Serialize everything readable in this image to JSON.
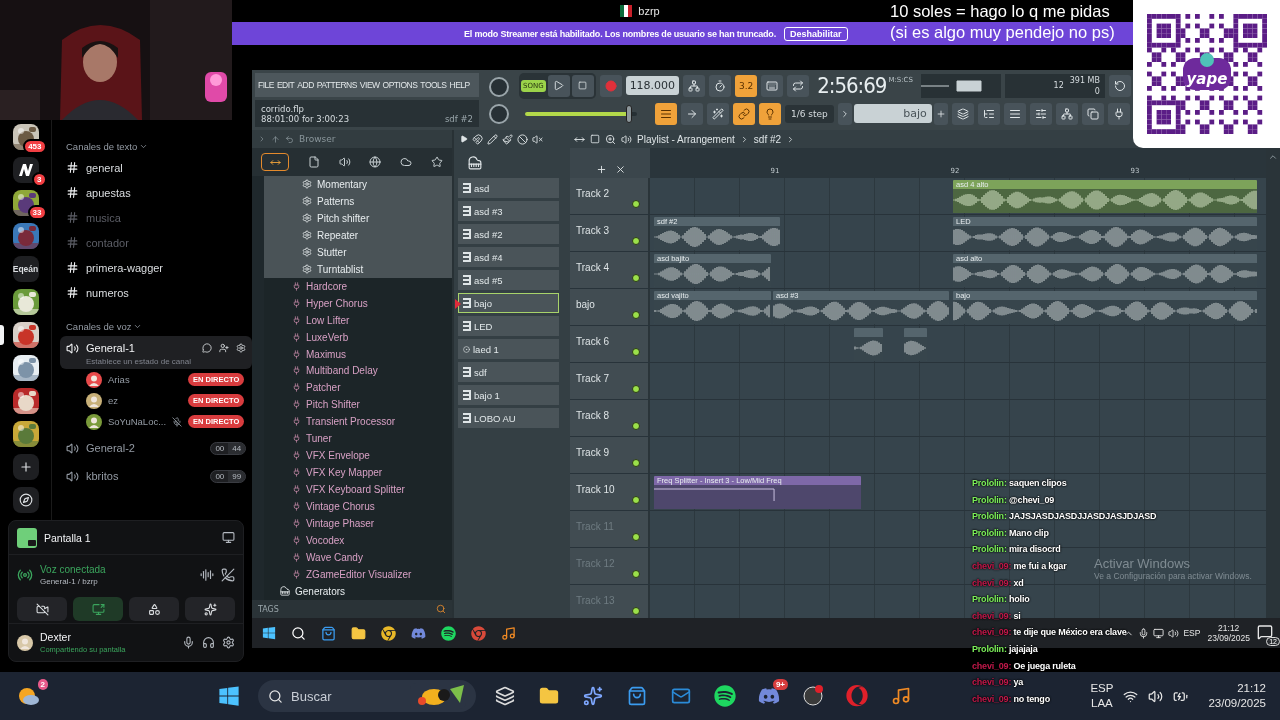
{
  "stream": {
    "title": "bzrp",
    "promo_lines": [
      "10 soles = hago lo q me pidas",
      "(si es algo muy pendejo no ps)"
    ],
    "qr_logo": "yape"
  },
  "banner": {
    "message": "El modo Streamer está habilitado. Los nombres de usuario se han truncado.",
    "button": "Deshabilitar"
  },
  "discord": {
    "servers": [
      {
        "kind": "picture",
        "badge": "453",
        "selected": false
      },
      {
        "kind": "logo",
        "badge": "3",
        "selected": false
      },
      {
        "kind": "picture",
        "badge": "33",
        "selected": false
      },
      {
        "kind": "picture",
        "selected": false
      },
      {
        "kind": "text",
        "label": "Eqeán",
        "selected": false
      },
      {
        "kind": "picture",
        "selected": false
      },
      {
        "kind": "picture",
        "selected": true
      },
      {
        "kind": "picture",
        "selected": false
      },
      {
        "kind": "picture",
        "selected": false
      },
      {
        "kind": "picture",
        "selected": false
      },
      {
        "kind": "add",
        "selected": false
      },
      {
        "kind": "explore",
        "selected": false
      }
    ],
    "text_category": "Canales de texto",
    "text_channels": [
      {
        "name": "general",
        "unread": true
      },
      {
        "name": "apuestas",
        "unread": true
      },
      {
        "name": "musica",
        "unread": false
      },
      {
        "name": "contador",
        "unread": false
      },
      {
        "name": "primera-wagger",
        "unread": true
      },
      {
        "name": "numeros",
        "unread": true
      }
    ],
    "voice_category": "Canales de voz",
    "voice_channels": [
      {
        "name": "General-1",
        "selected": true,
        "status": "Establece un estado de canal",
        "members": [
          {
            "name": "Arias",
            "muted": false,
            "live": "EN DIRECTO"
          },
          {
            "name": "ez",
            "muted": false,
            "live": "EN DIRECTO"
          },
          {
            "name": "SoYuNaLoc...",
            "muted": true,
            "live": "EN DIRECTO"
          }
        ]
      },
      {
        "name": "General-2",
        "selected": false,
        "count": "00",
        "limit": "44"
      },
      {
        "name": "kbritos",
        "selected": false,
        "count": "00",
        "limit": "99"
      }
    ],
    "stream_panel": {
      "title": "Pantalla 1"
    },
    "voice_panel": {
      "status": "Voz conectada",
      "channel": "General-1 / bzrp"
    },
    "user": {
      "name": "Dexter",
      "status": "Compartiendo su pantalla"
    }
  },
  "fl": {
    "menu": [
      "FILE",
      "EDIT",
      "ADD",
      "PATTERNS",
      "VIEW",
      "OPTIONS",
      "TOOLS",
      "HELP"
    ],
    "hint": {
      "file": "corrido.flp",
      "position": "88:01:00 for 3:00:23",
      "pattern": "sdf #2"
    },
    "mode": {
      "label": "SONG",
      "selected": true
    },
    "tempo": "118.000",
    "toggles_top": [
      {
        "on": false
      },
      {
        "on": false
      },
      {
        "label": "3.2",
        "on": true
      },
      {
        "on": false
      },
      {
        "on": false
      }
    ],
    "time": "2:56:69",
    "time_unit": "M:S:CS",
    "cpu": "12",
    "memory": "391 MB",
    "polyphony": "0",
    "master_volume": {
      "level": 0.93
    },
    "toggles_bottom": [
      {
        "on": true
      },
      {
        "on": false
      },
      {
        "on": false
      },
      {
        "on": true
      },
      {
        "on": true
      }
    ],
    "snap": "1/6 step",
    "pattern": "bajo",
    "browser": {
      "title": "Browser",
      "tags": "TAGS",
      "items": [
        {
          "kind": "preset",
          "name": "Momentary"
        },
        {
          "kind": "preset",
          "name": "Patterns"
        },
        {
          "kind": "preset",
          "name": "Pitch shifter"
        },
        {
          "kind": "preset",
          "name": "Repeater"
        },
        {
          "kind": "preset",
          "name": "Stutter"
        },
        {
          "kind": "preset",
          "name": "Turntablist"
        },
        {
          "kind": "plugin",
          "name": "Hardcore"
        },
        {
          "kind": "plugin",
          "name": "Hyper Chorus"
        },
        {
          "kind": "plugin",
          "name": "Low Lifter"
        },
        {
          "kind": "plugin",
          "name": "LuxeVerb"
        },
        {
          "kind": "plugin",
          "name": "Maximus"
        },
        {
          "kind": "plugin",
          "name": "Multiband Delay"
        },
        {
          "kind": "plugin",
          "name": "Patcher"
        },
        {
          "kind": "plugin",
          "name": "Pitch Shifter"
        },
        {
          "kind": "plugin",
          "name": "Transient Processor"
        },
        {
          "kind": "plugin",
          "name": "Tuner"
        },
        {
          "kind": "plugin",
          "name": "VFX Envelope"
        },
        {
          "kind": "plugin",
          "name": "VFX Key Mapper"
        },
        {
          "kind": "plugin",
          "name": "VFX Keyboard Splitter"
        },
        {
          "kind": "plugin",
          "name": "Vintage Chorus"
        },
        {
          "kind": "plugin",
          "name": "Vintage Phaser"
        },
        {
          "kind": "plugin",
          "name": "Vocodex"
        },
        {
          "kind": "plugin",
          "name": "Wave Candy"
        },
        {
          "kind": "plugin",
          "name": "ZGameEditor Visualizer"
        },
        {
          "kind": "folder",
          "name": "Generators"
        }
      ]
    },
    "patterns": [
      {
        "name": "asd",
        "kind": "steps",
        "selected": false
      },
      {
        "name": "asd #3",
        "kind": "steps",
        "selected": false
      },
      {
        "name": "asd #2",
        "kind": "steps",
        "selected": false
      },
      {
        "name": "asd #4",
        "kind": "steps",
        "selected": false
      },
      {
        "name": "asd #5",
        "kind": "steps",
        "selected": false
      },
      {
        "name": "bajo",
        "kind": "steps",
        "selected": true
      },
      {
        "name": "LED",
        "kind": "steps",
        "selected": false
      },
      {
        "name": "laed 1",
        "kind": "dot",
        "selected": false
      },
      {
        "name": "sdf",
        "kind": "steps",
        "selected": false
      },
      {
        "name": "bajo 1",
        "kind": "steps",
        "selected": false
      },
      {
        "name": "LOBO AU",
        "kind": "steps",
        "selected": false
      }
    ],
    "playlist": {
      "title": "Playlist - Arrangement",
      "pattern": "sdf #2",
      "ruler": [
        "91",
        "92",
        "93"
      ],
      "tracks": [
        {
          "name": "Track 2",
          "active": true,
          "clips": [
            {
              "kind": "audio",
              "name": "asd 4 alto",
              "color": "#7da35a"
            }
          ]
        },
        {
          "name": "Track 3",
          "active": true,
          "clips": [
            {
              "kind": "audio",
              "name": "sdf #2",
              "color": "#55656d"
            },
            {
              "kind": "audio",
              "name": "LED",
              "color": "#55656d"
            }
          ]
        },
        {
          "name": "Track 4",
          "active": true,
          "clips": [
            {
              "kind": "audio",
              "name": "asd bajito",
              "color": "#55656d"
            },
            {
              "kind": "audio",
              "name": "asd alto",
              "color": "#55656d"
            }
          ]
        },
        {
          "name": "bajo",
          "active": true,
          "clips": [
            {
              "kind": "audio",
              "name": "asd vajito",
              "color": "#55656d"
            },
            {
              "kind": "audio",
              "name": "asd #3",
              "color": "#55656d"
            },
            {
              "kind": "audio",
              "name": "bajo",
              "color": "#55656d"
            }
          ]
        },
        {
          "name": "Track 6",
          "active": true,
          "clips": [
            {
              "kind": "audio",
              "color": "#55656d"
            },
            {
              "kind": "audio",
              "color": "#55656d"
            }
          ]
        },
        {
          "name": "Track 7",
          "active": true
        },
        {
          "name": "Track 8",
          "active": true
        },
        {
          "name": "Track 9",
          "active": true
        },
        {
          "name": "Track 10",
          "active": true,
          "clips": [
            {
              "kind": "automation",
              "name": "Freq Splitter - Insert 3 - Low/Mid Freq",
              "color": "#7e68a8"
            }
          ]
        },
        {
          "name": "Track 11",
          "active": false
        },
        {
          "name": "Track 12",
          "active": false
        },
        {
          "name": "Track 13",
          "active": false
        }
      ]
    }
  },
  "inner_taskbar": {
    "lang": "ESP",
    "time": "21:12",
    "date": "23/09/2025",
    "notifications": "12"
  },
  "taskbar": {
    "weather_badge": "2",
    "search_placeholder": "Buscar",
    "app_badge": "9+",
    "lang": "ESP",
    "layout": "LAA",
    "time": "21:12",
    "date": "23/09/2025"
  },
  "activation": {
    "title": "Activar Windows",
    "subtitle": "Ve a Configuración para activar Windows."
  },
  "chat": [
    {
      "user": "Prololin:",
      "text": "saquen clipos",
      "color": "#7cf05a"
    },
    {
      "user": "Prololin:",
      "text": "@chevi_09",
      "color": "#7cf05a"
    },
    {
      "user": "Prololin:",
      "text": "JAJSJASDJASDJJASDJASJDJASD",
      "color": "#7cf05a"
    },
    {
      "user": "Prololin:",
      "text": "Mano clip",
      "color": "#7cf05a"
    },
    {
      "user": "Prololin:",
      "text": "mira disocrd",
      "color": "#7cf05a"
    },
    {
      "user": "chevi_09:",
      "text": "me fui a kgar",
      "color": "#c2184a"
    },
    {
      "user": "chevi_09:",
      "text": "xd",
      "color": "#c2184a"
    },
    {
      "user": "Prololin:",
      "text": "holio",
      "color": "#7cf05a"
    },
    {
      "user": "chevi_09:",
      "text": "si",
      "color": "#c2184a"
    },
    {
      "user": "chevi_09:",
      "text": "te dije que México era clave",
      "color": "#c2184a"
    },
    {
      "user": "Prololin:",
      "text": "jajajaja",
      "color": "#7cf05a"
    },
    {
      "user": "chevi_09:",
      "text": "Oe juega ruleta",
      "color": "#c2184a"
    },
    {
      "user": "chevi_09:",
      "text": "ya",
      "color": "#c2184a"
    },
    {
      "user": "chevi_09:",
      "text": "no tengo",
      "color": "#c2184a"
    }
  ]
}
